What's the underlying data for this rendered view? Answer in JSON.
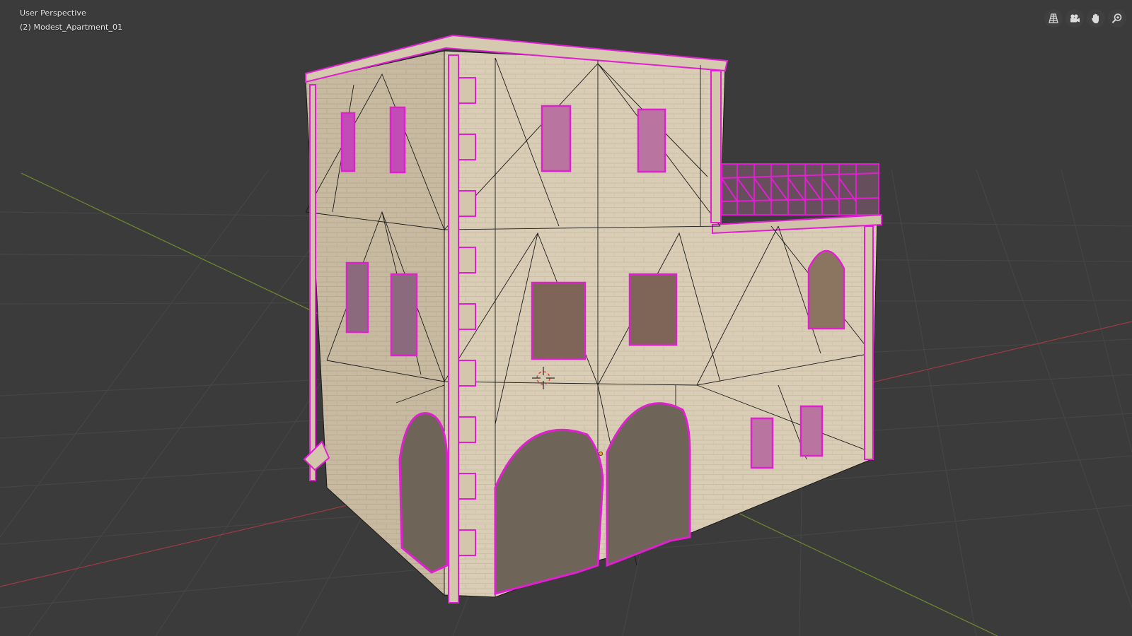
{
  "viewport": {
    "view_name": "User Perspective",
    "object_name": "(2) Modest_Apartment_01"
  },
  "navigation": [
    {
      "name": "toggle-ortho-icon"
    },
    {
      "name": "camera-view-icon"
    },
    {
      "name": "pan-hand-icon"
    },
    {
      "name": "zoom-icon"
    }
  ],
  "colors": {
    "background": "#3b3b3b",
    "grid": "#474747",
    "axis_x": "#9b3b45",
    "axis_y": "#6f8a2e",
    "selection": "#e020d0",
    "wall": "#d8ccb5",
    "wall_shade": "#b9ac94",
    "wireframe": "#1a1a1a"
  }
}
